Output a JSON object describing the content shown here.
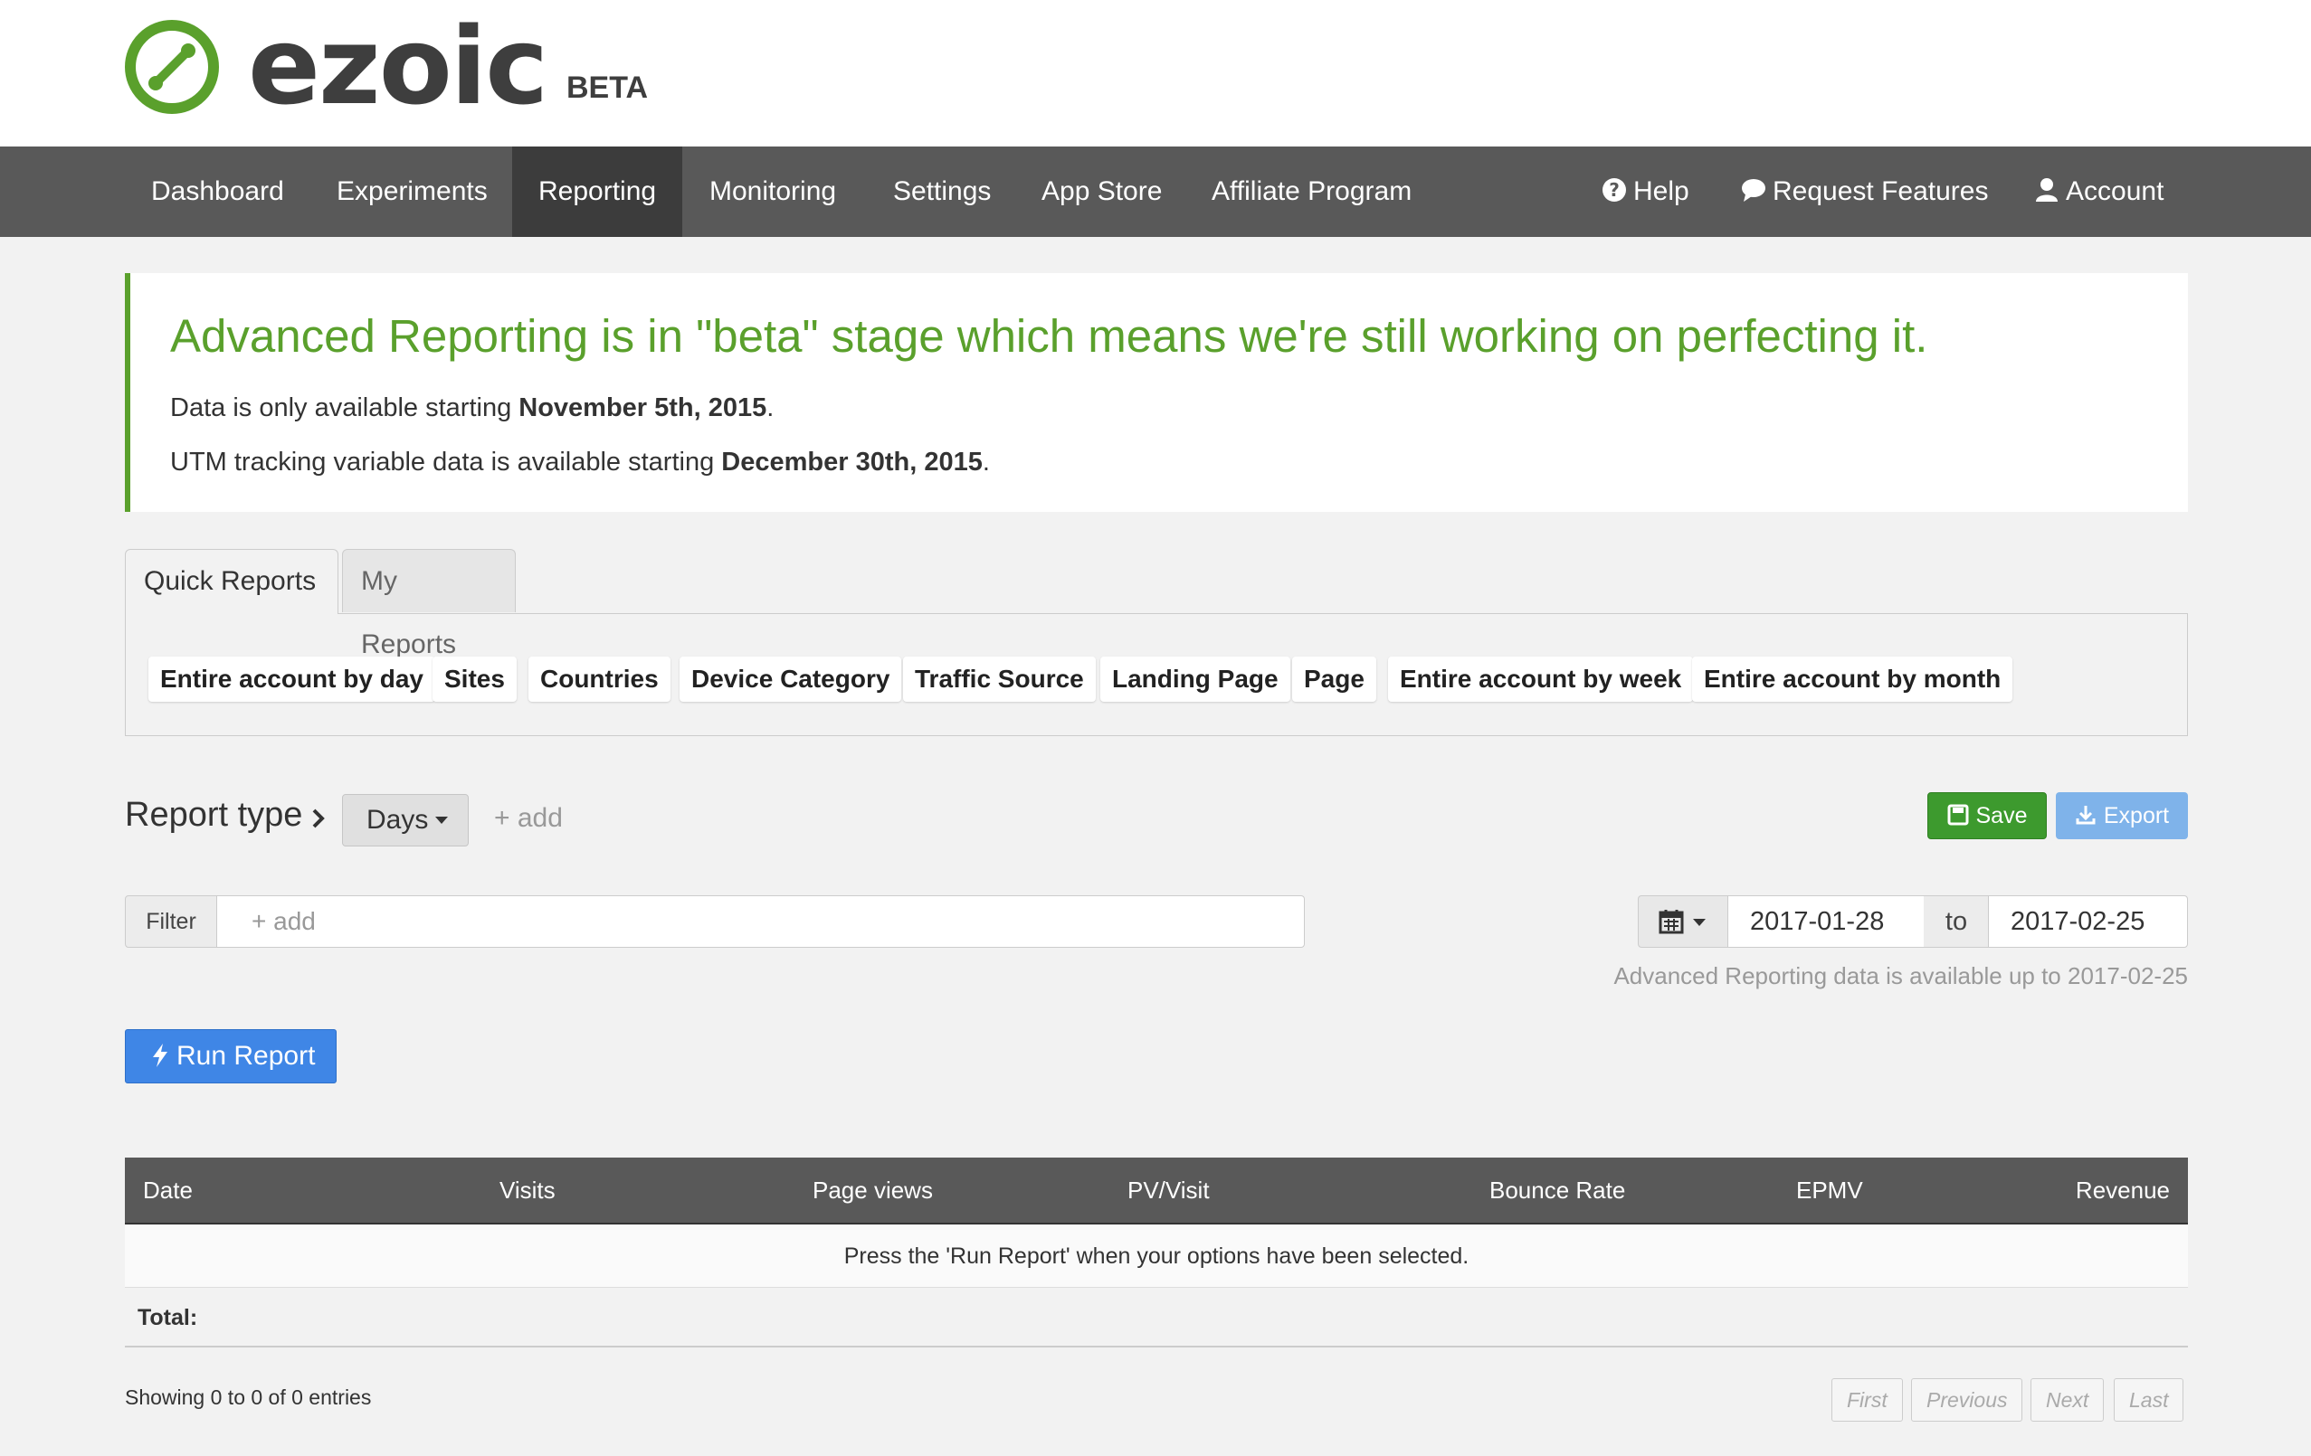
{
  "brand": {
    "name": "ezoic",
    "badge": "BETA"
  },
  "nav": {
    "items": [
      {
        "label": "Dashboard"
      },
      {
        "label": "Experiments"
      },
      {
        "label": "Reporting",
        "active": true
      },
      {
        "label": "Monitoring"
      },
      {
        "label": "Settings"
      },
      {
        "label": "App Store"
      },
      {
        "label": "Affiliate Program"
      }
    ],
    "right": [
      {
        "label": "Help",
        "icon": "question-circle-icon"
      },
      {
        "label": "Request Features",
        "icon": "comment-icon"
      },
      {
        "label": "Account",
        "icon": "user-icon"
      }
    ]
  },
  "notice": {
    "title": "Advanced Reporting is in \"beta\" stage which means we're still working on perfecting it.",
    "line1_prefix": "Data is only available starting ",
    "line1_date": "November 5th, 2015",
    "line1_suffix": ".",
    "line2_prefix": "UTM tracking variable data is available starting ",
    "line2_date": "December 30th, 2015",
    "line2_suffix": "."
  },
  "tabs": [
    {
      "label": "Quick Reports",
      "active": true
    },
    {
      "label": "My Reports"
    }
  ],
  "quick_reports": [
    "Entire account by day",
    "Sites",
    "Countries",
    "Device Category",
    "Traffic Source",
    "Landing Page",
    "Page",
    "Entire account by week",
    "Entire account by month"
  ],
  "report": {
    "type_label": "Report type",
    "type_value": "Days",
    "add_label": "+ add",
    "save_label": "Save",
    "export_label": "Export",
    "filter_label": "Filter",
    "filter_placeholder": "+ add",
    "date_from": "2017-01-28",
    "date_to_label": "to",
    "date_to": "2017-02-25",
    "availability": "Advanced Reporting data is available up to 2017-02-25",
    "run_label": "Run Report"
  },
  "table": {
    "columns": [
      "Date",
      "Visits",
      "Page views",
      "PV/Visit",
      "Bounce Rate",
      "EPMV",
      "Revenue"
    ],
    "empty_message": "Press the 'Run Report' when your options have been selected.",
    "total_label": "Total:",
    "info": "Showing 0 to 0 of 0 entries",
    "pagination": [
      "First",
      "Previous",
      "Next",
      "Last"
    ]
  },
  "colors": {
    "brand_green": "#5aa02c",
    "nav_bg": "#595959",
    "nav_active": "#3c3c3c",
    "save_green": "#3d9a2e",
    "export_blue": "#7fb3ea",
    "run_blue": "#3f86e6"
  }
}
